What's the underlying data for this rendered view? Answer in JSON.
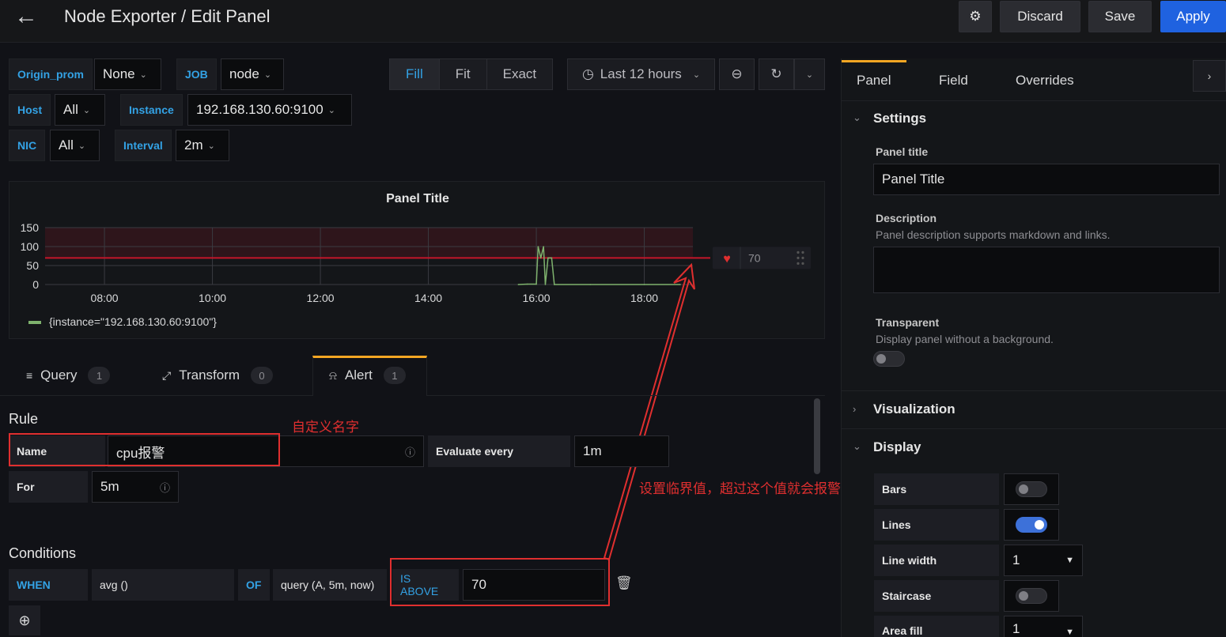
{
  "header": {
    "back_icon": "arrow-left-icon",
    "title": "Node Exporter / Edit Panel",
    "discard": "Discard",
    "save": "Save",
    "apply": "Apply"
  },
  "variables": [
    {
      "label": "Origin_prom",
      "value": "None"
    },
    {
      "label": "JOB",
      "value": "node"
    },
    {
      "label": "Host",
      "value": "All"
    },
    {
      "label": "Instance",
      "value": "192.168.130.60:9100"
    },
    {
      "label": "NIC",
      "value": "All"
    },
    {
      "label": "Interval",
      "value": "2m"
    }
  ],
  "view_modes": {
    "fill": "Fill",
    "fit": "Fit",
    "exact": "Exact",
    "active": "Fill"
  },
  "time_picker": {
    "label": "Last 12 hours"
  },
  "chart_data": {
    "type": "line",
    "title": "Panel Title",
    "x_ticks": [
      "08:00",
      "10:00",
      "12:00",
      "14:00",
      "16:00",
      "18:00"
    ],
    "y_ticks": [
      "150",
      "100",
      "50",
      "0"
    ],
    "ylim": [
      0,
      150
    ],
    "threshold": 70,
    "series": [
      {
        "name": "{instance=\"192.168.130.60:9100\"}",
        "color": "#7eb26d",
        "points": [
          [
            "15:40",
            0
          ],
          [
            "15:50",
            1
          ],
          [
            "16:00",
            1
          ],
          [
            "16:02",
            100
          ],
          [
            "16:05",
            70
          ],
          [
            "16:08",
            100
          ],
          [
            "16:10",
            0
          ],
          [
            "16:13",
            70
          ],
          [
            "16:17",
            70
          ],
          [
            "16:20",
            0
          ],
          [
            "17:00",
            0
          ],
          [
            "18:00",
            0
          ],
          [
            "18:40",
            0
          ]
        ]
      }
    ],
    "grid": true,
    "legend_position": "bottom-left"
  },
  "threshold_handle": {
    "value": "70"
  },
  "editor_tabs": [
    {
      "label": "Query",
      "count": "1"
    },
    {
      "label": "Transform",
      "count": "0"
    },
    {
      "label": "Alert",
      "count": "1"
    }
  ],
  "rule": {
    "section": "Rule",
    "name_label": "Name",
    "name_value": "cpu报警",
    "evaluate_label": "Evaluate every",
    "evaluate_value": "1m",
    "for_label": "For",
    "for_value": "5m"
  },
  "annotations": {
    "name_note": "自定义名字",
    "threshold_note": "设置临界值，超过这个值就会报警"
  },
  "conditions": {
    "section": "Conditions",
    "when": "WHEN",
    "reducer": "avg ()",
    "of": "OF",
    "query": "query (A, 5m, now)",
    "evaluator": "IS ABOVE",
    "value": "70"
  },
  "options_pane": {
    "tabs": [
      "Panel",
      "Field",
      "Overrides"
    ],
    "settings": "Settings",
    "panel_title_label": "Panel title",
    "panel_title_value": "Panel Title",
    "description_label": "Description",
    "description_hint": "Panel description supports markdown and links.",
    "transparent_label": "Transparent",
    "transparent_hint": "Display panel without a background.",
    "visualization": "Visualization",
    "display": "Display",
    "bars": "Bars",
    "lines": "Lines",
    "line_width": "Line width",
    "line_width_value": "1",
    "staircase": "Staircase",
    "area_fill": "Area fill",
    "area_fill_value": "1"
  },
  "colors": {
    "accent": "#33a2e5",
    "primary": "#1f62e0",
    "annotation": "#e02f2f",
    "series": "#7eb26d",
    "threshold": "#c4162a"
  }
}
